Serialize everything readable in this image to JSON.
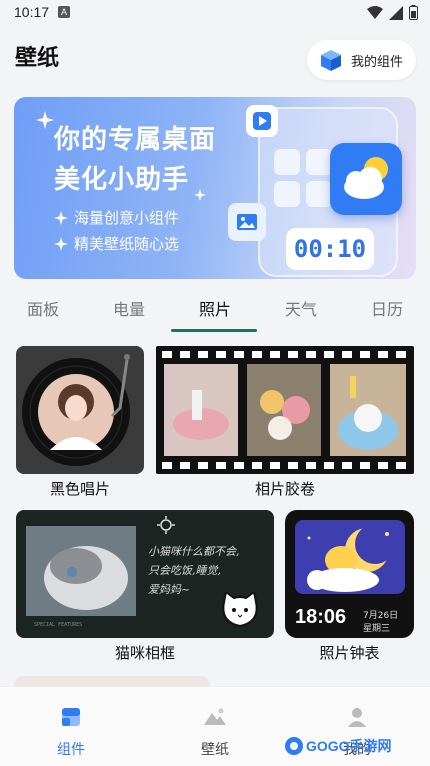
{
  "status_bar": {
    "time": "10:17",
    "notification_badge": "A"
  },
  "header": {
    "title": "壁纸",
    "widget_button_label": "我的组件"
  },
  "banner": {
    "headline_line1": "你的专属桌面",
    "headline_line2": "美化小助手",
    "feature1": "海量创意小组件",
    "feature2": "精美壁纸随心选",
    "timer_text": "00:10"
  },
  "tabs": [
    {
      "label": "面板"
    },
    {
      "label": "电量"
    },
    {
      "label": "照片",
      "active": true
    },
    {
      "label": "天气"
    },
    {
      "label": "日历"
    }
  ],
  "cards": [
    {
      "label": "黑色唱片"
    },
    {
      "label": "相片胶卷"
    },
    {
      "label": "猫咪相框",
      "handwriting": [
        "小猫咪什么都不会,",
        "只会吃饭,睡觉,",
        "爱妈妈~"
      ],
      "caption": "SPECIAL FEATURES"
    },
    {
      "label": "照片钟表",
      "time": "18:06",
      "date": "7月26日",
      "weekday": "星期三"
    }
  ],
  "bottom_nav": [
    {
      "label": "组件",
      "icon": "widget-icon",
      "active": true
    },
    {
      "label": "壁纸",
      "icon": "mountain-image-icon"
    },
    {
      "label": "我的",
      "icon": "person-icon"
    }
  ],
  "watermark": {
    "text": "GOGO手游网"
  },
  "colors": {
    "accent_blue": "#2f7cf5",
    "tab_underline": "#1f6f66",
    "background": "#f3f4f6"
  }
}
